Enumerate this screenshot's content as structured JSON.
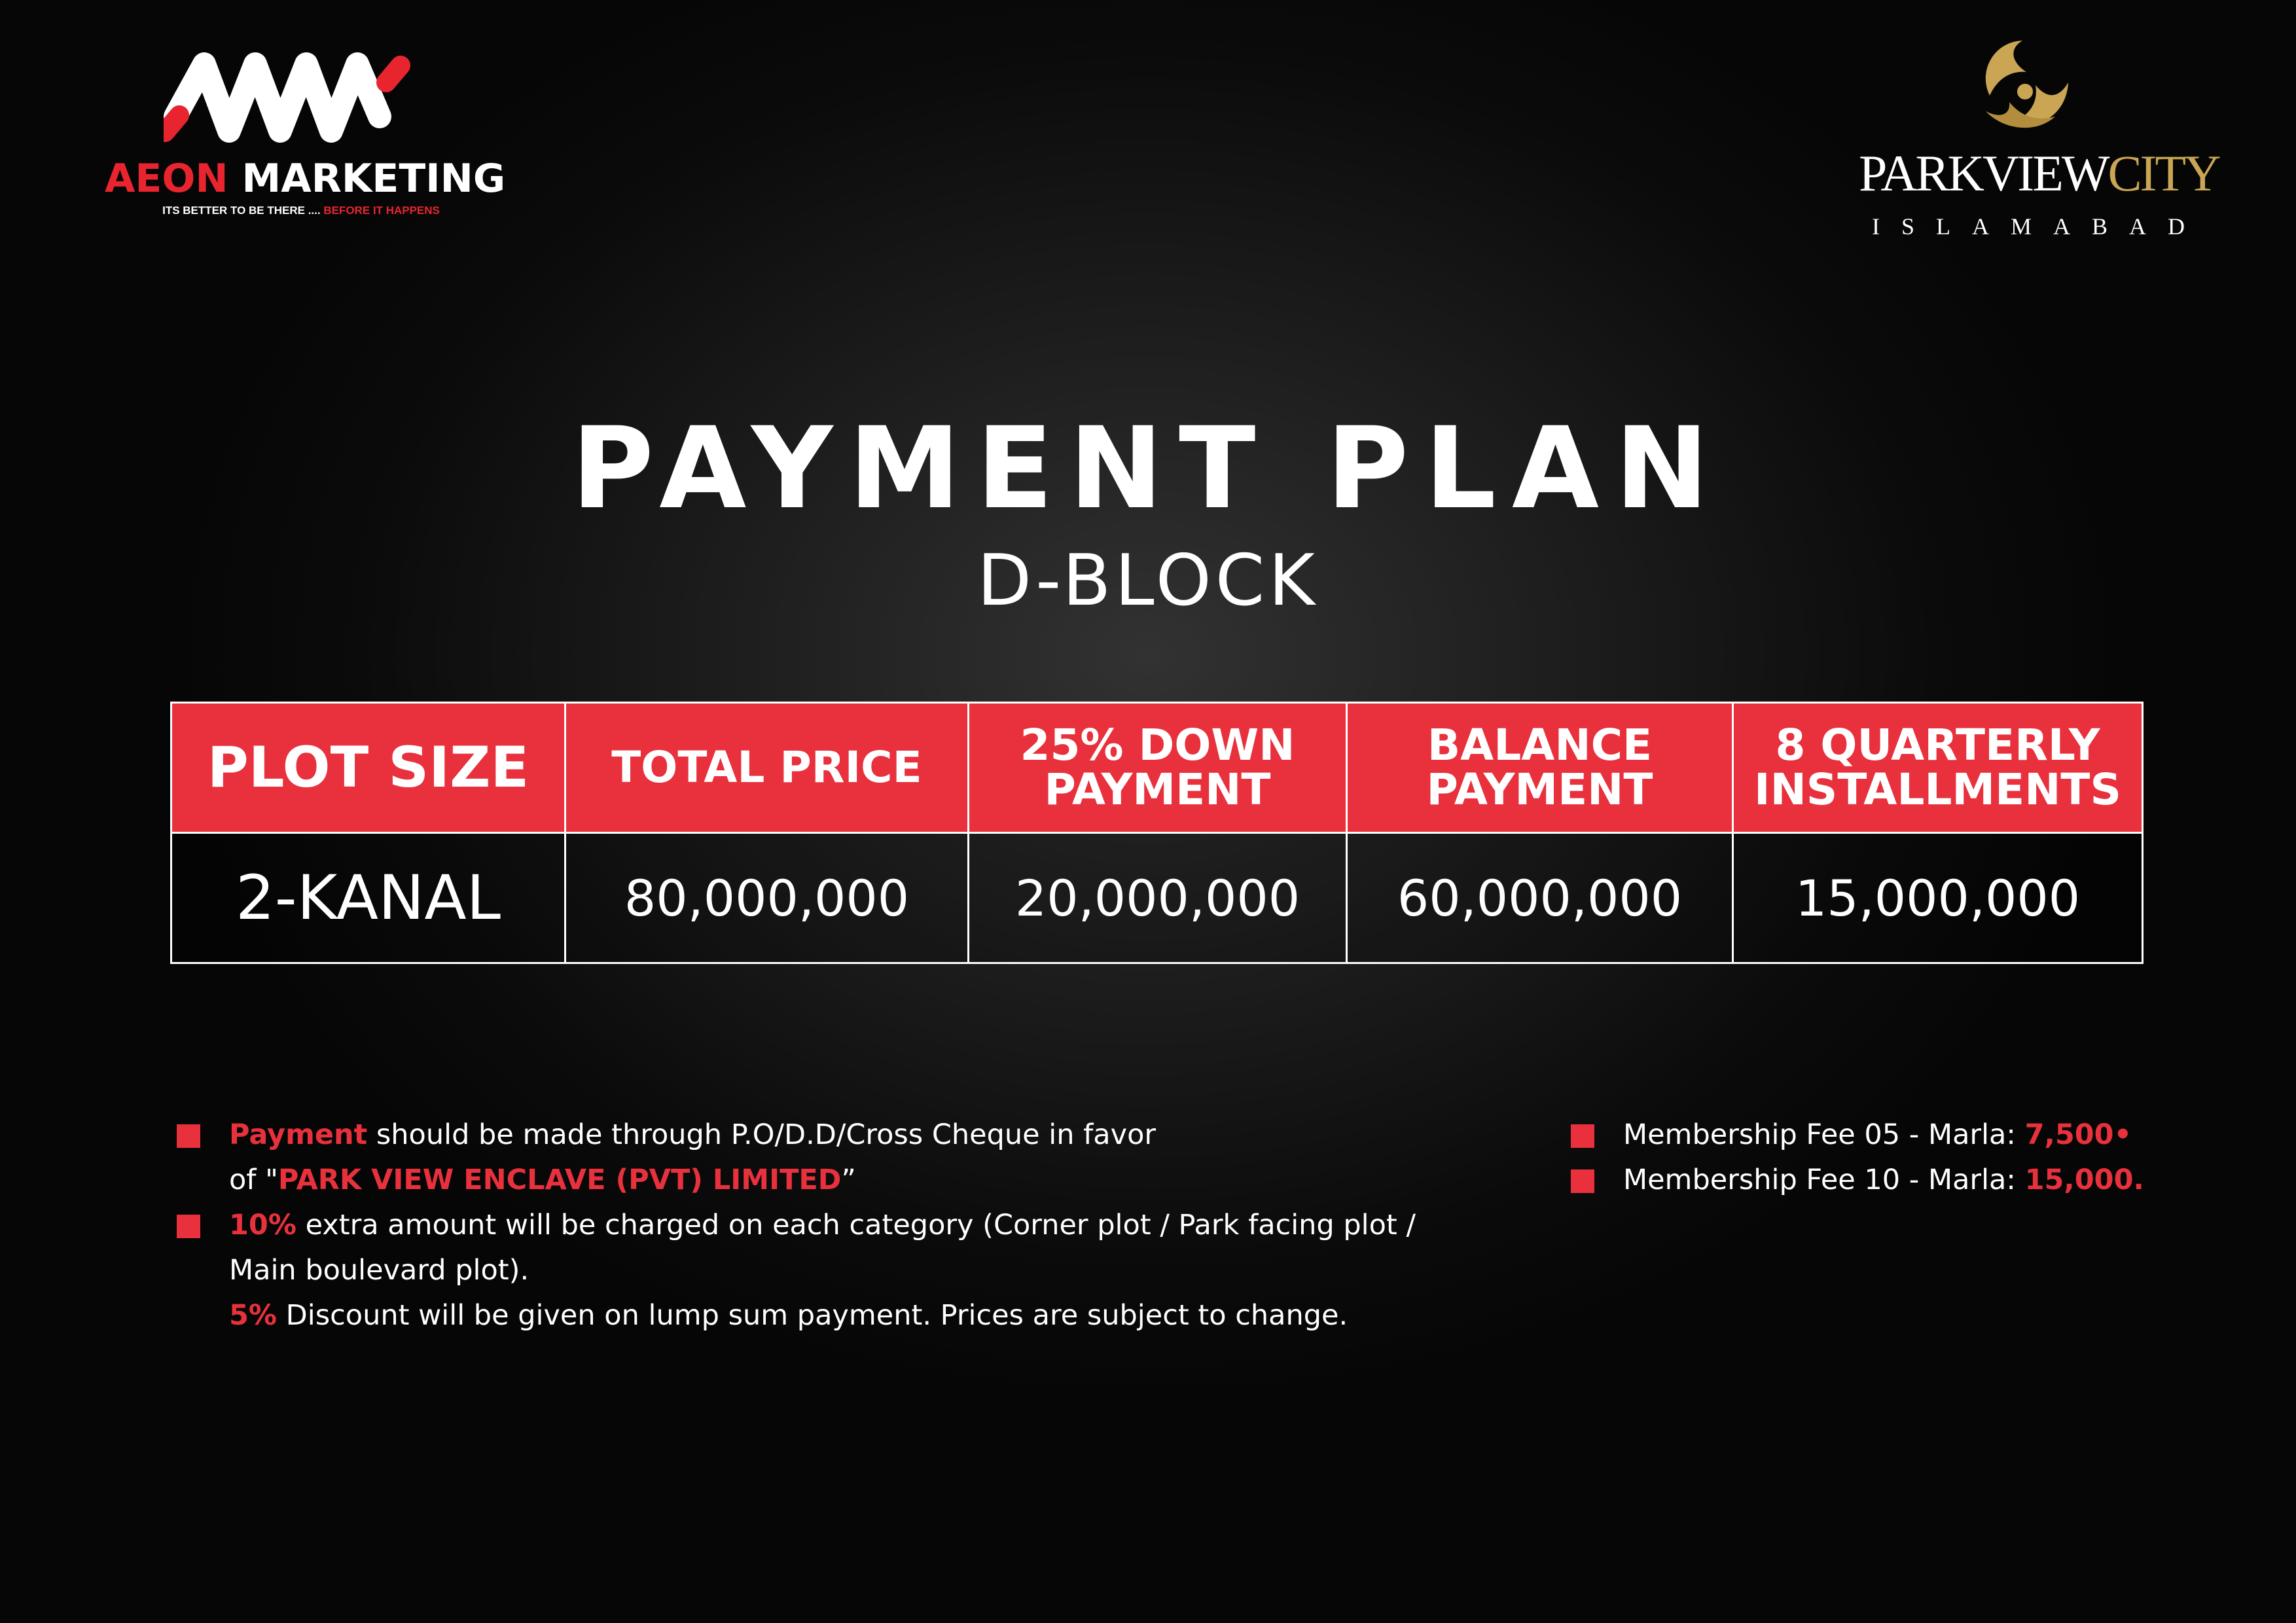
{
  "brand_left": {
    "name_part1": "AEON",
    "name_part2": "MARKETING",
    "tagline_part1": "ITS BETTER TO BE THERE .... ",
    "tagline_part2": "BEFORE IT HAPPENS"
  },
  "brand_right": {
    "name_part1": "PARKVIEW",
    "name_part2": "CITY",
    "city": "ISLAMABAD"
  },
  "title": "PAYMENT PLAN",
  "subtitle": "D-BLOCK",
  "table": {
    "headers": {
      "plot_size": "PLOT SIZE",
      "total_price": "TOTAL PRICE",
      "down_payment_line1": "25% DOWN",
      "down_payment_line2": "PAYMENT",
      "balance_line1": "BALANCE",
      "balance_line2": "PAYMENT",
      "installments_line1": "8 QUARTERLY",
      "installments_line2": "INSTALLMENTS"
    },
    "row": {
      "plot_size": "2-KANAL",
      "total_price": "80,000,000",
      "down_payment": "20,000,000",
      "balance": "60,000,000",
      "installments": "15,000,000"
    }
  },
  "notes": {
    "n1_red": "Payment",
    "n1_text": " should be made through P.O/D.D/Cross Cheque in favor",
    "n1b_pre": "of \"",
    "n1b_red": "PARK VIEW ENCLAVE (PVT) LIMITED",
    "n1b_post": "”",
    "n2_red": "10%",
    "n2_text": " extra amount will be charged on each category (Corner plot / Park facing plot /",
    "n2b_text": "Main boulevard plot).",
    "n3_red": "5%",
    "n3_text": " Discount will be given on lump sum payment. Prices are subject to change."
  },
  "fees": {
    "f1_text": "Membership Fee 05 - Marla: ",
    "f1_value": "7,500•",
    "f2_text": "Membership Fee 10 - Marla: ",
    "f2_value": "15,000."
  },
  "colors": {
    "accent_red": "#e8313c",
    "gold": "#c9a554",
    "background": "#0b0b0b"
  }
}
